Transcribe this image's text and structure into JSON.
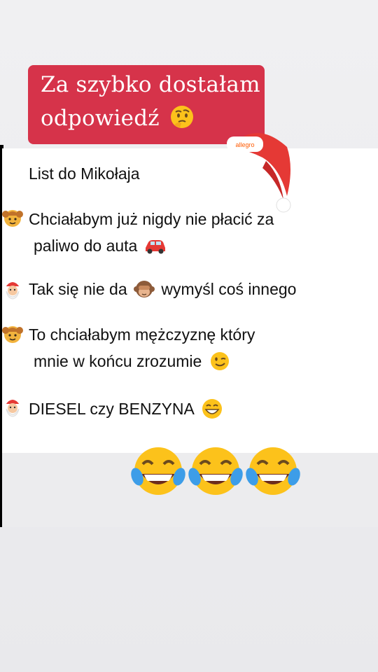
{
  "title": {
    "line1": "Za szybko dostałam",
    "line2": "odpowiedź"
  },
  "hat": {
    "brand": "allegro"
  },
  "letter": {
    "heading": "List do Mikołaja",
    "messages": [
      {
        "speaker": "girl",
        "line1": "Chciałabym już nigdy nie płacić za",
        "line2": "paliwo do auta"
      },
      {
        "speaker": "santa",
        "line1": "Tak się nie da",
        "line1b": "wymyśl coś innego"
      },
      {
        "speaker": "girl",
        "line1": "To chciałabym mężczyznę który",
        "line2": "mnie w  końcu zrozumie"
      },
      {
        "speaker": "santa",
        "line1": "DIESEL czy BENZYNA"
      }
    ]
  },
  "icons": {
    "thinking": "thinking-face-icon",
    "car": "car-icon",
    "monkey": "see-no-evil-monkey-icon",
    "wink": "winking-face-icon",
    "grin": "grinning-face-icon",
    "laugh": "tears-of-joy-icon"
  },
  "colors": {
    "banner": "#d6334a",
    "emoji_yellow": "#fcc21b",
    "santa_red": "#e53935"
  }
}
